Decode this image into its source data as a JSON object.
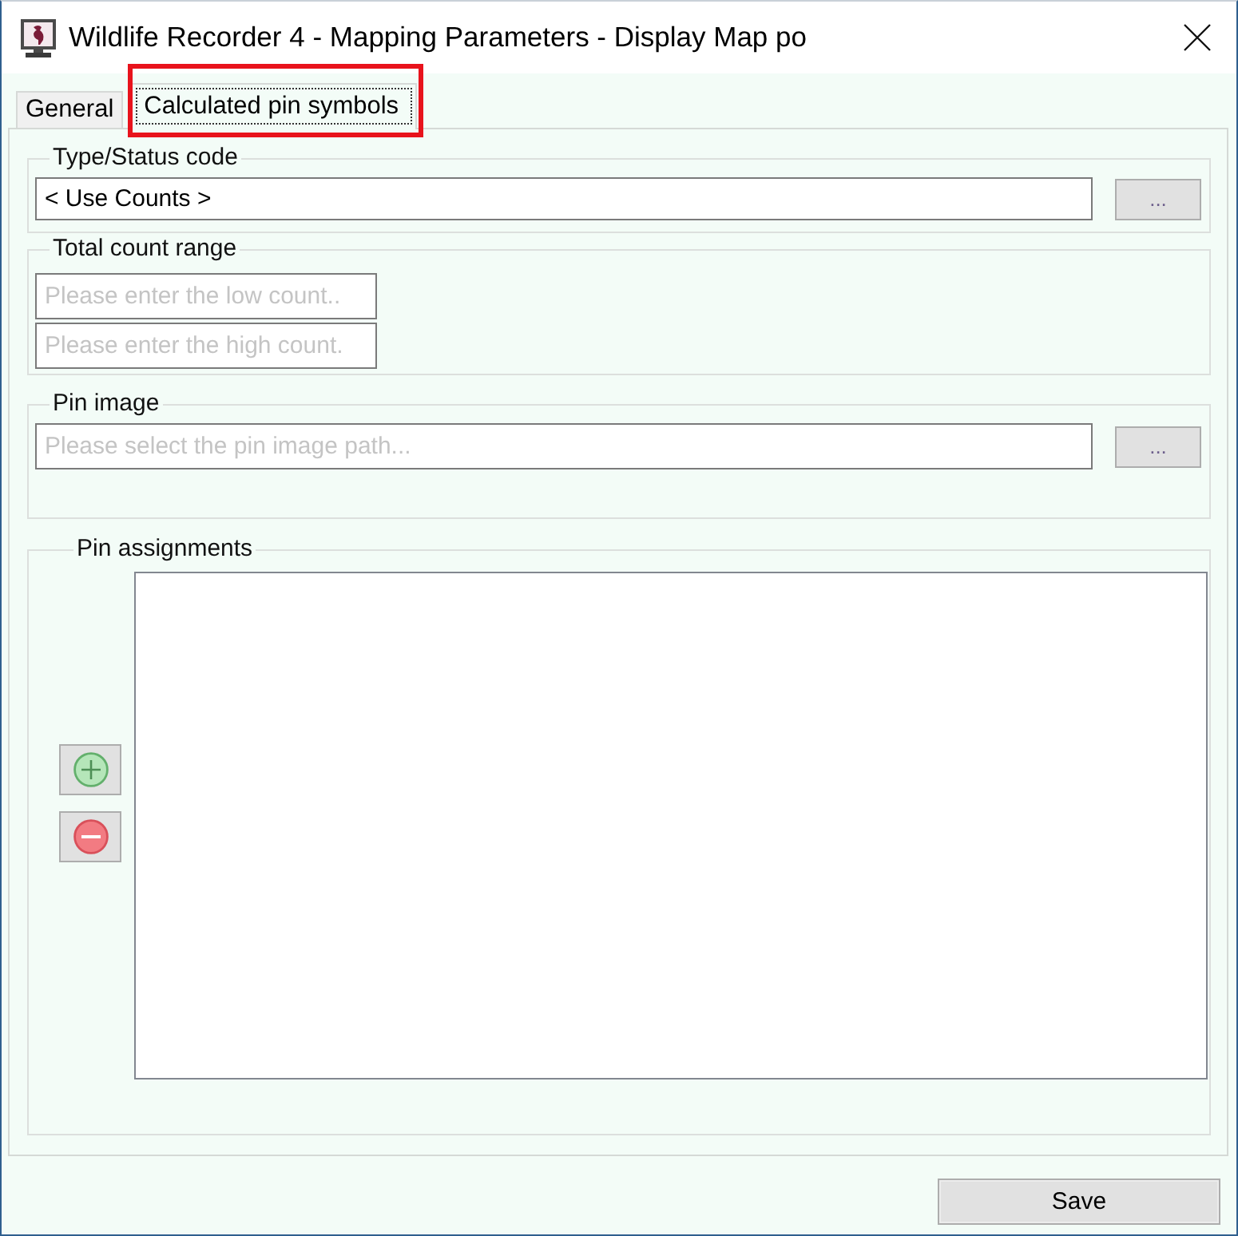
{
  "window": {
    "title": "Wildlife Recorder 4 - Mapping Parameters - Display Map po"
  },
  "tabs": [
    {
      "label": "General",
      "selected": false,
      "highlighted": false
    },
    {
      "label": "Calculated pin symbols",
      "selected": true,
      "highlighted": true
    }
  ],
  "type_status_code": {
    "label": "Type/Status code",
    "value": "< Use Counts >",
    "browse_button": "..."
  },
  "total_count_range": {
    "label": "Total count range",
    "low": {
      "placeholder": "Please enter the low count.."
    },
    "high": {
      "placeholder": "Please enter the high count."
    }
  },
  "pin_image": {
    "label": "Pin image",
    "placeholder": "Please select the pin image path...",
    "browse_button": "..."
  },
  "pin_assignments": {
    "label": "Pin assignments"
  },
  "buttons": [
    {
      "label": "Save"
    }
  ]
}
